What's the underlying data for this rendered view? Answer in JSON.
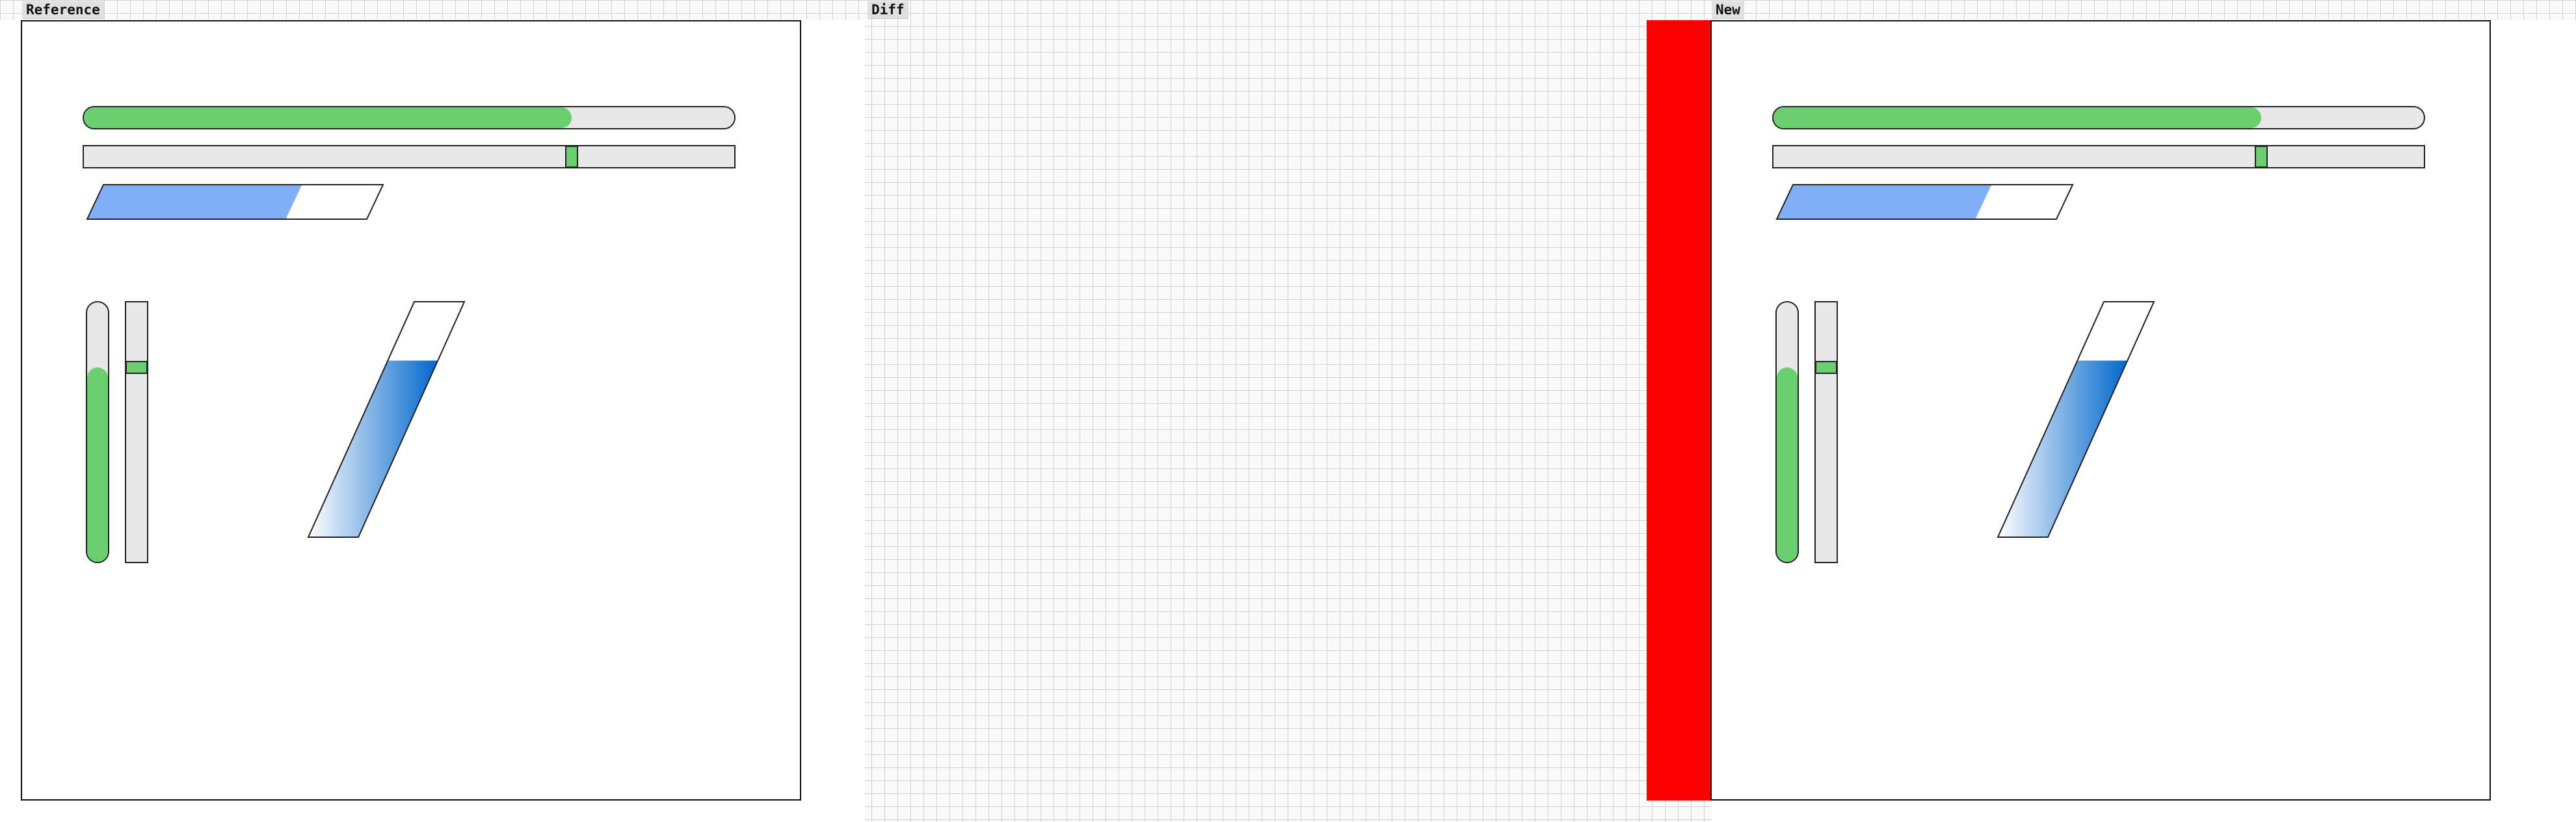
{
  "labels": {
    "reference": "Reference",
    "diff": "Diff",
    "new": "New"
  },
  "colors": {
    "progress_green": "#6acf6f",
    "skew_blue": "#7fb0f7",
    "gradient_blue_dark": "#0066cc",
    "diff_red": "#ff0000",
    "track_gray": "#e8e8e8"
  },
  "widgets": {
    "horizontal_progress_fraction": 0.75,
    "horizontal_slider_fraction": 0.75,
    "skewed_bar_fraction": 0.71,
    "vertical_progress_fraction": 0.75,
    "vertical_slider_fraction": 0.75,
    "skewed_vertical_fraction": 0.75
  }
}
